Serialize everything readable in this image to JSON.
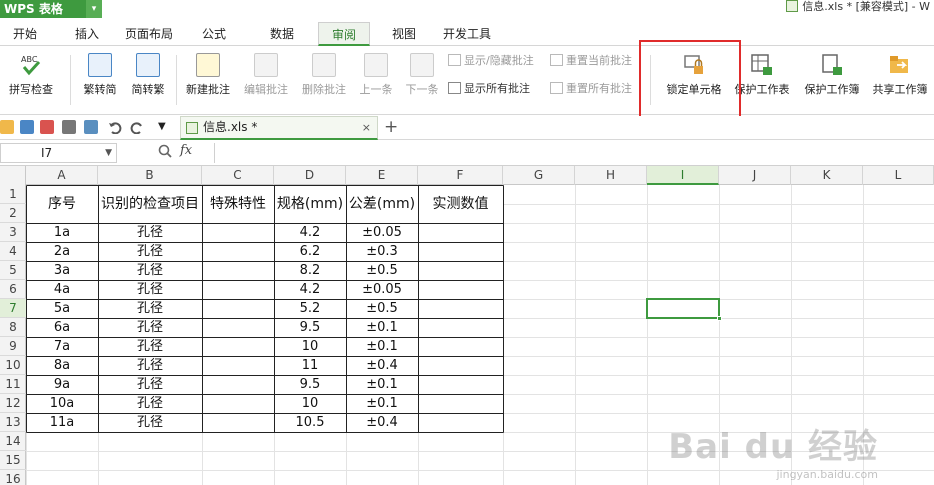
{
  "app": {
    "name": "WPS 表格",
    "arrow": "▾"
  },
  "window": {
    "title": "信息.xls * [兼容模式] - W"
  },
  "tabs": [
    "开始",
    "插入",
    "页面布局",
    "公式",
    "数据",
    "审阅",
    "视图",
    "开发工具"
  ],
  "active_tab_index": 5,
  "ribbon": {
    "spellcheck": "拼写检查",
    "trad_to_simp": "繁转简",
    "simp_to_trad": "简转繁",
    "new_comment": "新建批注",
    "edit_comment": "编辑批注",
    "delete_comment": "删除批注",
    "prev": "上一条",
    "next": "下一条",
    "show_hide_comment": "显示/隐藏批注",
    "reset_current_comment": "重置当前批注",
    "show_all_comments": "显示所有批注",
    "reset_all_comments": "重置所有批注",
    "lock_cell": "锁定单元格",
    "protect_sheet": "保护工作表",
    "protect_workbook": "保护工作簿",
    "share_workbook": "共享工作簿",
    "abc_label": "ABC"
  },
  "icons": {
    "spellcheck": "check-icon",
    "lock": "lock-icon",
    "protect_sheet": "sheet-lock-icon",
    "protect_workbook": "workbook-lock-icon",
    "share": "share-folder-icon"
  },
  "quickbar": {
    "file_tab": "信息.xls *",
    "close": "×",
    "add": "+"
  },
  "formula_bar": {
    "cell_ref": "I7",
    "fx": "fx",
    "value": ""
  },
  "columns": [
    "A",
    "B",
    "C",
    "D",
    "E",
    "F",
    "G",
    "H",
    "I",
    "J",
    "K",
    "L"
  ],
  "selected_column": "I",
  "rows": [
    "1",
    "2",
    "3",
    "4",
    "5",
    "6",
    "7",
    "8",
    "9",
    "10",
    "11",
    "12",
    "13",
    "14",
    "15",
    "16"
  ],
  "selected_row": "7",
  "table": {
    "headers": [
      "序号",
      "识别的检查项目",
      "特殊特性",
      "规格(mm)",
      "公差(mm)",
      "实测数值"
    ],
    "rows": [
      [
        "1a",
        "孔径",
        "",
        "4.2",
        "±0.05",
        ""
      ],
      [
        "2a",
        "孔径",
        "",
        "6.2",
        "±0.3",
        ""
      ],
      [
        "3a",
        "孔径",
        "",
        "8.2",
        "±0.5",
        ""
      ],
      [
        "4a",
        "孔径",
        "",
        "4.2",
        "±0.05",
        ""
      ],
      [
        "5a",
        "孔径",
        "",
        "5.2",
        "±0.5",
        ""
      ],
      [
        "6a",
        "孔径",
        "",
        "9.5",
        "±0.1",
        ""
      ],
      [
        "7a",
        "孔径",
        "",
        "10",
        "±0.1",
        ""
      ],
      [
        "8a",
        "孔径",
        "",
        "11",
        "±0.4",
        ""
      ],
      [
        "9a",
        "孔径",
        "",
        "9.5",
        "±0.1",
        ""
      ],
      [
        "10a",
        "孔径",
        "",
        "10",
        "±0.1",
        ""
      ],
      [
        "11a",
        "孔径",
        "",
        "10.5",
        "±0.4",
        ""
      ]
    ]
  },
  "watermark": {
    "logo": "Bai du 经验",
    "url": "jingyan.baidu.com"
  },
  "colors": {
    "accent": "#3e9a3f",
    "highlight": "#e02b2b"
  }
}
